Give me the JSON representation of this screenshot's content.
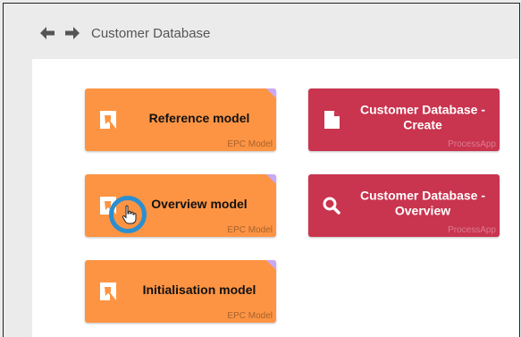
{
  "breadcrumb": {
    "title": "Customer Database"
  },
  "tiles": [
    {
      "title": "Reference model",
      "type_label": "EPC Model",
      "kind": "epc",
      "color": "#fd9443"
    },
    {
      "title": "Customer Database - Create",
      "type_label": "ProcessApp",
      "kind": "app-create",
      "color": "#c9344f"
    },
    {
      "title": "Overview model",
      "type_label": "EPC Model",
      "kind": "epc",
      "color": "#fd9443"
    },
    {
      "title": "Customer Database - Overview",
      "type_label": "ProcessApp",
      "kind": "app-search",
      "color": "#c9344f"
    },
    {
      "title": "Initialisation model",
      "type_label": "EPC Model",
      "kind": "epc",
      "color": "#fd9443"
    }
  ],
  "icons": {
    "back": "arrow-left-icon",
    "forward": "arrow-right-icon",
    "cursor": "hand-pointer-icon"
  }
}
